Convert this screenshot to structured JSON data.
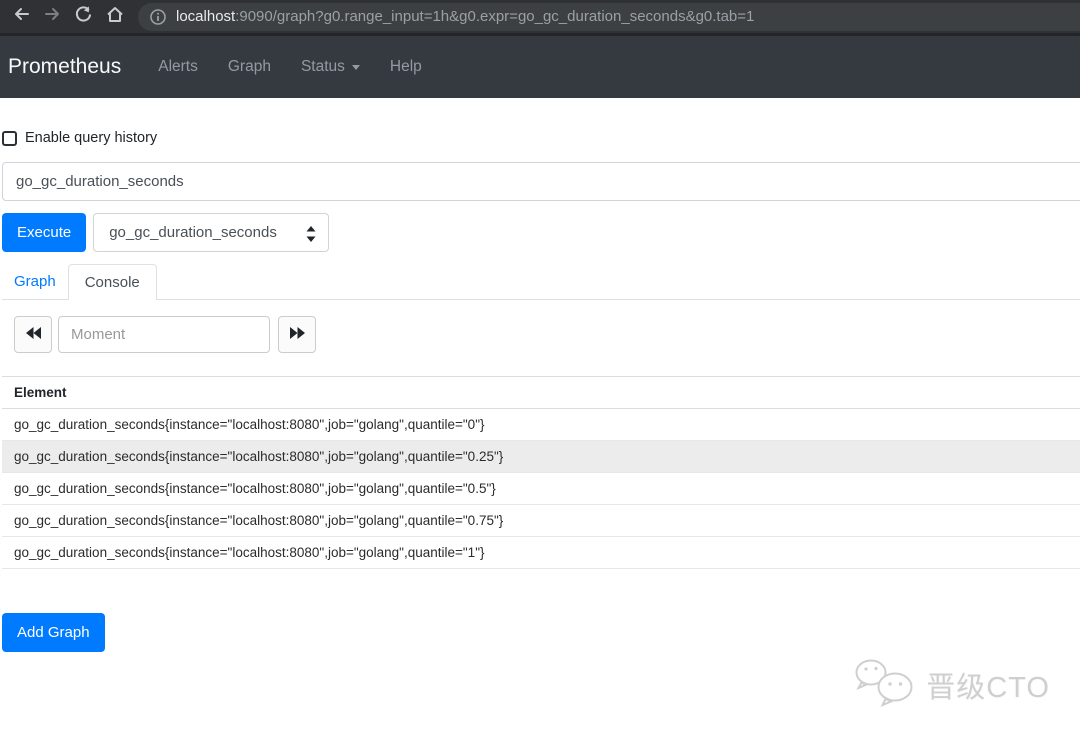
{
  "browser": {
    "url_host": "localhost",
    "url_rest": ":9090/graph?g0.range_input=1h&g0.expr=go_gc_duration_seconds&g0.tab=1"
  },
  "navbar": {
    "brand": "Prometheus",
    "items": [
      {
        "label": "Alerts"
      },
      {
        "label": "Graph"
      },
      {
        "label": "Status"
      },
      {
        "label": "Help"
      }
    ]
  },
  "query": {
    "history_label": "Enable query history",
    "history_checked": false,
    "expression": "go_gc_duration_seconds",
    "execute_label": "Execute",
    "metric_selected": "go_gc_duration_seconds"
  },
  "tabs": {
    "graph_label": "Graph",
    "console_label": "Console",
    "active": "Console"
  },
  "console": {
    "moment_placeholder": "Moment",
    "moment_value": "",
    "table": {
      "header": "Element",
      "rows": [
        {
          "text": "go_gc_duration_seconds{instance=\"localhost:8080\",job=\"golang\",quantile=\"0\"}",
          "highlighted": false
        },
        {
          "text": "go_gc_duration_seconds{instance=\"localhost:8080\",job=\"golang\",quantile=\"0.25\"}",
          "highlighted": true
        },
        {
          "text": "go_gc_duration_seconds{instance=\"localhost:8080\",job=\"golang\",quantile=\"0.5\"}",
          "highlighted": false
        },
        {
          "text": "go_gc_duration_seconds{instance=\"localhost:8080\",job=\"golang\",quantile=\"0.75\"}",
          "highlighted": false
        },
        {
          "text": "go_gc_duration_seconds{instance=\"localhost:8080\",job=\"golang\",quantile=\"1\"}",
          "highlighted": false
        }
      ]
    }
  },
  "footer": {
    "add_graph_label": "Add Graph"
  },
  "watermark": {
    "icon": "wechat-icon",
    "text": "晋级CTO"
  },
  "icons": {
    "back": "left-arrow",
    "forward": "right-arrow",
    "reload": "circular-arrow",
    "home": "house",
    "info": "circled-i",
    "metric_dropdown": "up-down-triangles",
    "step_back": "double-left-triangles",
    "step_forward": "double-right-triangles",
    "status_caret": "down-triangle"
  },
  "colors": {
    "primary": "#007bff",
    "navbar_bg": "#343a40",
    "chrome_bg": "#303134",
    "url_pill_bg": "#3d4043",
    "row_highlight": "#ececec"
  }
}
